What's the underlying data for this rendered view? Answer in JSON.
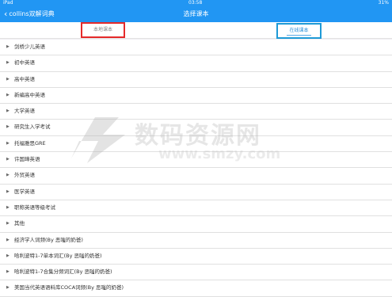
{
  "status_bar": {
    "device": "iPad",
    "time": "03:58",
    "battery": "31%"
  },
  "nav": {
    "back_label": "collins双解词典",
    "title": "选择课本"
  },
  "tabs": {
    "local": "本地课本",
    "online": "在线课本"
  },
  "books": [
    "剑桥少儿英语",
    "初中英语",
    "高中英语",
    "新编高中英语",
    "大学英语",
    "研究生入学考试",
    "托福雅思GRE",
    "许国璋英语",
    "外贸英语",
    "医学英语",
    "职称英语等级考试",
    "其他",
    "经济学人词频(By 恶嗤的奶爸)",
    "哈利波特1-7单本词汇(By 恶嗤的奶爸)",
    "哈利波特1-7合集分频词汇(By 恶嗤的奶爸)",
    "美国当代英语语料库COCA词频(By 恶嗤的奶爸)"
  ],
  "watermark": {
    "text": "数码资源网",
    "url": "www.smzy.com"
  },
  "colors": {
    "nav": "#2196f3",
    "local_highlight": "#e52a2a",
    "online_highlight": "#1e9ad6"
  }
}
